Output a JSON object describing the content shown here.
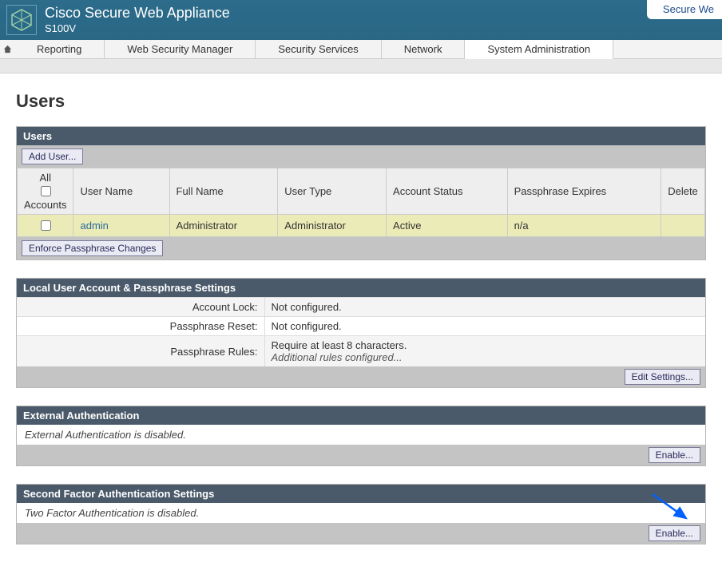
{
  "header": {
    "product": "Cisco Secure Web Appliance",
    "model": "S100V",
    "right": "Secure We"
  },
  "nav": {
    "items": [
      "Reporting",
      "Web Security Manager",
      "Security Services",
      "Network",
      "System Administration"
    ],
    "activeIndex": 4
  },
  "page": {
    "title": "Users"
  },
  "usersPanel": {
    "title": "Users",
    "addUser": "Add User...",
    "enforce": "Enforce Passphrase Changes",
    "columns": {
      "allTop": "All",
      "allBottom": "Accounts",
      "username": "User Name",
      "fullname": "Full Name",
      "usertype": "User Type",
      "status": "Account Status",
      "expires": "Passphrase Expires",
      "delete": "Delete"
    },
    "rows": [
      {
        "username": "admin",
        "fullname": "Administrator",
        "usertype": "Administrator",
        "status": "Active",
        "expires": "n/a",
        "delete": ""
      }
    ]
  },
  "localSettings": {
    "title": "Local User Account & Passphrase Settings",
    "rows": [
      {
        "k": "Account Lock:",
        "v": "Not configured."
      },
      {
        "k": "Passphrase Reset:",
        "v": "Not configured."
      },
      {
        "k": "Passphrase Rules:",
        "v": "Require at least 8 characters.",
        "v2": "Additional rules configured..."
      }
    ],
    "editBtn": "Edit Settings..."
  },
  "extAuth": {
    "title": "External Authentication",
    "body": "External Authentication is disabled.",
    "btn": "Enable..."
  },
  "secondFactor": {
    "title": "Second Factor Authentication Settings",
    "body": "Two Factor Authentication is disabled.",
    "btn": "Enable..."
  }
}
